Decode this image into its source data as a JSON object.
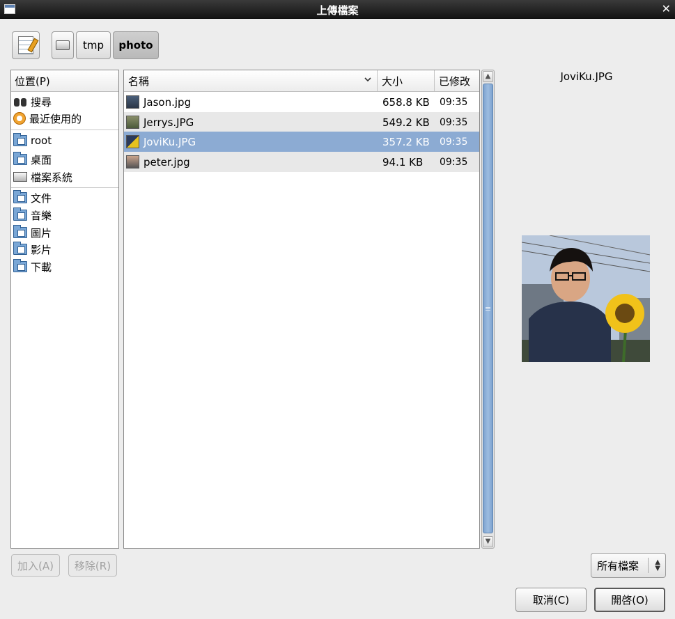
{
  "window": {
    "title": "上傳檔案"
  },
  "pathbar": {
    "segments": [
      "tmp",
      "photo"
    ],
    "active": "photo"
  },
  "places": {
    "header": "位置(P)",
    "items": [
      {
        "label": "搜尋",
        "icon": "search-icon"
      },
      {
        "label": "最近使用的",
        "icon": "recent-icon"
      },
      {
        "label": "root",
        "icon": "home-folder-icon"
      },
      {
        "label": "桌面",
        "icon": "desktop-folder-icon"
      },
      {
        "label": "檔案系統",
        "icon": "drive-icon"
      },
      {
        "label": "文件",
        "icon": "documents-folder-icon"
      },
      {
        "label": "音樂",
        "icon": "music-folder-icon"
      },
      {
        "label": "圖片",
        "icon": "pictures-folder-icon"
      },
      {
        "label": "影片",
        "icon": "videos-folder-icon"
      },
      {
        "label": "下載",
        "icon": "downloads-folder-icon"
      }
    ],
    "add_label": "加入(A)",
    "remove_label": "移除(R)"
  },
  "filelist": {
    "columns": {
      "name": "名稱",
      "size": "大小",
      "modified": "已修改"
    },
    "rows": [
      {
        "name": "Jason.jpg",
        "size": "658.8 KB",
        "modified": "09:35",
        "selected": false
      },
      {
        "name": "Jerrys.JPG",
        "size": "549.2 KB",
        "modified": "09:35",
        "selected": false
      },
      {
        "name": "JoviKu.JPG",
        "size": "357.2 KB",
        "modified": "09:35",
        "selected": true
      },
      {
        "name": "peter.jpg",
        "size": "94.1 KB",
        "modified": "09:35",
        "selected": false
      }
    ]
  },
  "preview": {
    "filename": "JoviKu.JPG"
  },
  "filter": {
    "selected": "所有檔案"
  },
  "buttons": {
    "cancel": "取消(C)",
    "open": "開啓(O)"
  },
  "colors": {
    "selection": "#8cabd3",
    "titlebar": "#1e1e1e",
    "scroll_thumb": "#8aaed6"
  }
}
